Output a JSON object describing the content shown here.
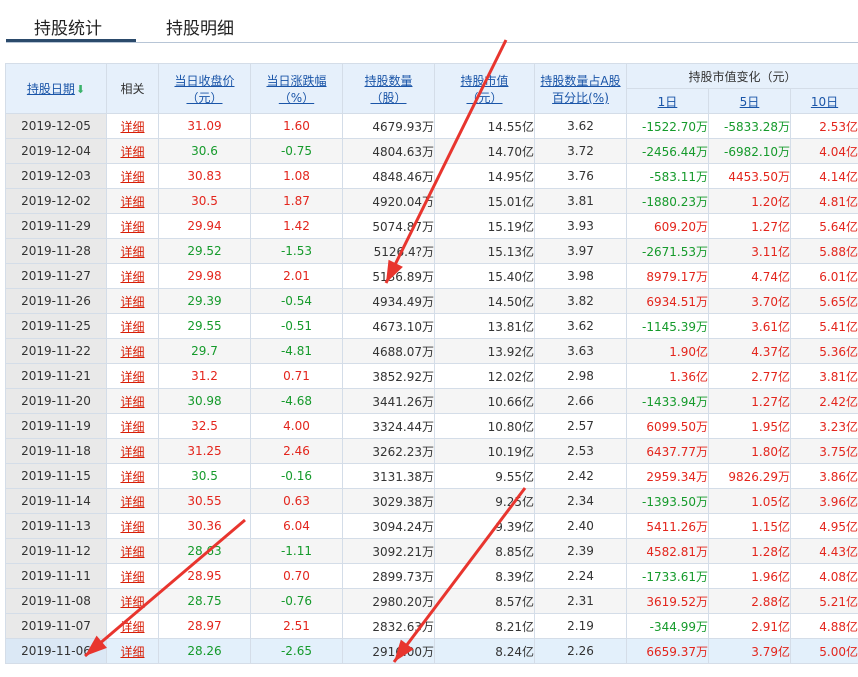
{
  "tabs": [
    {
      "label": "持股统计",
      "active": true
    },
    {
      "label": "持股明细",
      "active": false
    }
  ],
  "header": {
    "date": "持股日期",
    "related": "相关",
    "close_price": [
      "当日收盘价",
      "（元）"
    ],
    "change_pct": [
      "当日涨跌幅",
      "（%）"
    ],
    "shares": [
      "持股数量",
      "（股）"
    ],
    "market_value": [
      "持股市值",
      "（元）"
    ],
    "share_ratio": [
      "持股数量占A股",
      "百分比(%)"
    ],
    "mv_change": "持股市值变化（元）",
    "d1": "1日",
    "d5": "5日",
    "d10": "10日"
  },
  "colors": {
    "up": "#e3251c",
    "down": "#159a2b",
    "arrow": "#e8352e"
  },
  "rows": [
    {
      "date": "2019-12-05",
      "detail": "详细",
      "close": "31.09",
      "chg": "1.60",
      "shares": "4679.93万",
      "mv": "14.55亿",
      "ratio": "3.62",
      "d1": "-1522.70万",
      "d5": "-5833.28万",
      "d10": "2.53亿",
      "dir": "up",
      "c1": "down",
      "c5": "down",
      "c10": "up"
    },
    {
      "date": "2019-12-04",
      "detail": "详细",
      "close": "30.6",
      "chg": "-0.75",
      "shares": "4804.63万",
      "mv": "14.70亿",
      "ratio": "3.72",
      "d1": "-2456.44万",
      "d5": "-6982.10万",
      "d10": "4.04亿",
      "dir": "down",
      "c1": "down",
      "c5": "down",
      "c10": "up"
    },
    {
      "date": "2019-12-03",
      "detail": "详细",
      "close": "30.83",
      "chg": "1.08",
      "shares": "4848.46万",
      "mv": "14.95亿",
      "ratio": "3.76",
      "d1": "-583.11万",
      "d5": "4453.50万",
      "d10": "4.14亿",
      "dir": "up",
      "c1": "down",
      "c5": "up",
      "c10": "up"
    },
    {
      "date": "2019-12-02",
      "detail": "详细",
      "close": "30.5",
      "chg": "1.87",
      "shares": "4920.04万",
      "mv": "15.01亿",
      "ratio": "3.81",
      "d1": "-1880.23万",
      "d5": "1.20亿",
      "d10": "4.81亿",
      "dir": "up",
      "c1": "down",
      "c5": "up",
      "c10": "up"
    },
    {
      "date": "2019-11-29",
      "detail": "详细",
      "close": "29.94",
      "chg": "1.42",
      "shares": "5074.87万",
      "mv": "15.19亿",
      "ratio": "3.93",
      "d1": "609.20万",
      "d5": "1.27亿",
      "d10": "5.64亿",
      "dir": "up",
      "c1": "up",
      "c5": "up",
      "c10": "up"
    },
    {
      "date": "2019-11-28",
      "detail": "详细",
      "close": "29.52",
      "chg": "-1.53",
      "shares": "5126.4?万",
      "mv": "15.13亿",
      "ratio": "3.97",
      "d1": "-2671.53万",
      "d5": "3.11亿",
      "d10": "5.88亿",
      "dir": "down",
      "c1": "down",
      "c5": "up",
      "c10": "up"
    },
    {
      "date": "2019-11-27",
      "detail": "详细",
      "close": "29.98",
      "chg": "2.01",
      "shares": "5136.89万",
      "mv": "15.40亿",
      "ratio": "3.98",
      "d1": "8979.17万",
      "d5": "4.74亿",
      "d10": "6.01亿",
      "dir": "up",
      "c1": "up",
      "c5": "up",
      "c10": "up"
    },
    {
      "date": "2019-11-26",
      "detail": "详细",
      "close": "29.39",
      "chg": "-0.54",
      "shares": "4934.49万",
      "mv": "14.50亿",
      "ratio": "3.82",
      "d1": "6934.51万",
      "d5": "3.70亿",
      "d10": "5.65亿",
      "dir": "down",
      "c1": "up",
      "c5": "up",
      "c10": "up"
    },
    {
      "date": "2019-11-25",
      "detail": "详细",
      "close": "29.55",
      "chg": "-0.51",
      "shares": "4673.10万",
      "mv": "13.81亿",
      "ratio": "3.62",
      "d1": "-1145.39万",
      "d5": "3.61亿",
      "d10": "5.41亿",
      "dir": "down",
      "c1": "down",
      "c5": "up",
      "c10": "up"
    },
    {
      "date": "2019-11-22",
      "detail": "详细",
      "close": "29.7",
      "chg": "-4.81",
      "shares": "4688.07万",
      "mv": "13.92亿",
      "ratio": "3.63",
      "d1": "1.90亿",
      "d5": "4.37亿",
      "d10": "5.36亿",
      "dir": "down",
      "c1": "up",
      "c5": "up",
      "c10": "up"
    },
    {
      "date": "2019-11-21",
      "detail": "详细",
      "close": "31.2",
      "chg": "0.71",
      "shares": "3852.92万",
      "mv": "12.02亿",
      "ratio": "2.98",
      "d1": "1.36亿",
      "d5": "2.77亿",
      "d10": "3.81亿",
      "dir": "up",
      "c1": "up",
      "c5": "up",
      "c10": "up"
    },
    {
      "date": "2019-11-20",
      "detail": "详细",
      "close": "30.98",
      "chg": "-4.68",
      "shares": "3441.26万",
      "mv": "10.66亿",
      "ratio": "2.66",
      "d1": "-1433.94万",
      "d5": "1.27亿",
      "d10": "2.42亿",
      "dir": "down",
      "c1": "down",
      "c5": "up",
      "c10": "up"
    },
    {
      "date": "2019-11-19",
      "detail": "详细",
      "close": "32.5",
      "chg": "4.00",
      "shares": "3324.44万",
      "mv": "10.80亿",
      "ratio": "2.57",
      "d1": "6099.50万",
      "d5": "1.95亿",
      "d10": "3.23亿",
      "dir": "up",
      "c1": "up",
      "c5": "up",
      "c10": "up"
    },
    {
      "date": "2019-11-18",
      "detail": "详细",
      "close": "31.25",
      "chg": "2.46",
      "shares": "3262.23万",
      "mv": "10.19亿",
      "ratio": "2.53",
      "d1": "6437.77万",
      "d5": "1.80亿",
      "d10": "3.75亿",
      "dir": "up",
      "c1": "up",
      "c5": "up",
      "c10": "up"
    },
    {
      "date": "2019-11-15",
      "detail": "详细",
      "close": "30.5",
      "chg": "-0.16",
      "shares": "3131.38万",
      "mv": "9.55亿",
      "ratio": "2.42",
      "d1": "2959.34万",
      "d5": "9826.29万",
      "d10": "3.86亿",
      "dir": "down",
      "c1": "up",
      "c5": "up",
      "c10": "up"
    },
    {
      "date": "2019-11-14",
      "detail": "详细",
      "close": "30.55",
      "chg": "0.63",
      "shares": "3029.38万",
      "mv": "9.25亿",
      "ratio": "2.34",
      "d1": "-1393.50万",
      "d5": "1.05亿",
      "d10": "3.96亿",
      "dir": "up",
      "c1": "down",
      "c5": "up",
      "c10": "up"
    },
    {
      "date": "2019-11-13",
      "detail": "详细",
      "close": "30.36",
      "chg": "6.04",
      "shares": "3094.24万",
      "mv": "9.39亿",
      "ratio": "2.40",
      "d1": "5411.26万",
      "d5": "1.15亿",
      "d10": "4.95亿",
      "dir": "up",
      "c1": "up",
      "c5": "up",
      "c10": "up"
    },
    {
      "date": "2019-11-12",
      "detail": "详细",
      "close": "28.63",
      "chg": "-1.11",
      "shares": "3092.21万",
      "mv": "8.85亿",
      "ratio": "2.39",
      "d1": "4582.81万",
      "d5": "1.28亿",
      "d10": "4.43亿",
      "dir": "down",
      "c1": "up",
      "c5": "up",
      "c10": "up"
    },
    {
      "date": "2019-11-11",
      "detail": "详细",
      "close": "28.95",
      "chg": "0.70",
      "shares": "2899.73万",
      "mv": "8.39亿",
      "ratio": "2.24",
      "d1": "-1733.61万",
      "d5": "1.96亿",
      "d10": "4.08亿",
      "dir": "up",
      "c1": "down",
      "c5": "up",
      "c10": "up"
    },
    {
      "date": "2019-11-08",
      "detail": "详细",
      "close": "28.75",
      "chg": "-0.76",
      "shares": "2980.20万",
      "mv": "8.57亿",
      "ratio": "2.31",
      "d1": "3619.52万",
      "d5": "2.88亿",
      "d10": "5.21亿",
      "dir": "down",
      "c1": "up",
      "c5": "up",
      "c10": "up"
    },
    {
      "date": "2019-11-07",
      "detail": "详细",
      "close": "28.97",
      "chg": "2.51",
      "shares": "2832.63万",
      "mv": "8.21亿",
      "ratio": "2.19",
      "d1": "-344.99万",
      "d5": "2.91亿",
      "d10": "4.88亿",
      "dir": "up",
      "c1": "down",
      "c5": "up",
      "c10": "up"
    },
    {
      "date": "2019-11-06",
      "detail": "详细",
      "close": "28.26",
      "chg": "-2.65",
      "shares": "2916.00万",
      "mv": "8.24亿",
      "ratio": "2.26",
      "d1": "6659.37万",
      "d5": "3.79亿",
      "d10": "5.00亿",
      "dir": "down",
      "c1": "up",
      "c5": "up",
      "c10": "up"
    }
  ]
}
